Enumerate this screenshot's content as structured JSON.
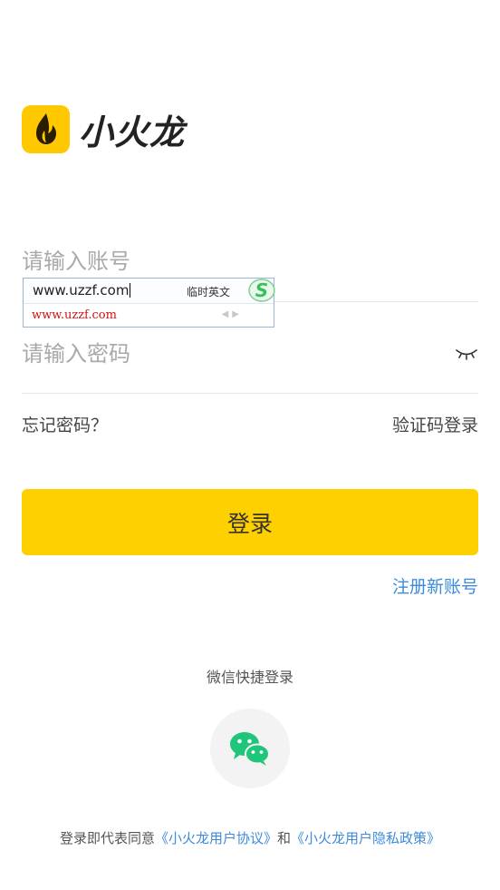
{
  "brand": {
    "name": "小火龙",
    "logo_color": "#ffc800"
  },
  "form": {
    "account_placeholder": "请输入账号",
    "password_placeholder": "请输入密码",
    "password_toggle_icon": "eye-closed-icon"
  },
  "ime": {
    "composition": "www.uzzf.com",
    "mode_label": "临时英文",
    "candidate": "www.uzzf.com",
    "logo_icon": "sogou-logo-icon"
  },
  "links": {
    "forgot_password": "忘记密码？",
    "sms_login": "验证码登录",
    "register": "注册新账号"
  },
  "login_button": "登录",
  "wechat": {
    "title": "微信快捷登录",
    "icon": "wechat-icon"
  },
  "agreement": {
    "prefix": "登录即代表同意",
    "user_agreement": "《小火龙用户协议》",
    "conjunction": "和",
    "privacy_policy": "《小火龙用户隐私政策》"
  },
  "colors": {
    "accent": "#ffd000",
    "link": "#3d8bdc",
    "wechat_green": "#1fc67a"
  }
}
